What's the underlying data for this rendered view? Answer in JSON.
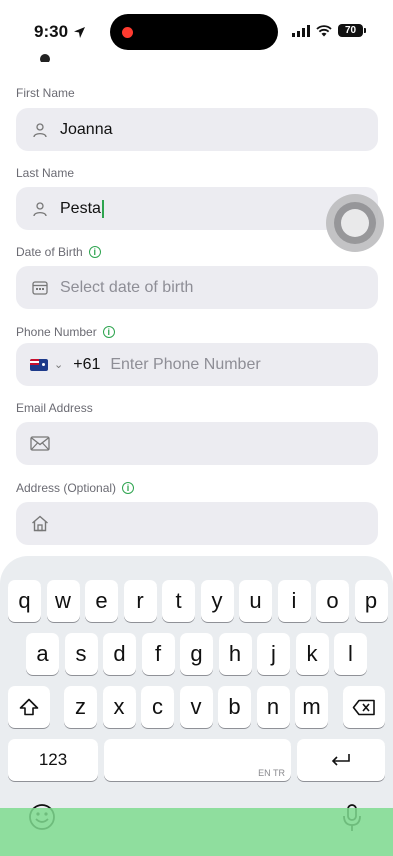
{
  "status_bar": {
    "time": "9:30",
    "battery": "70"
  },
  "form": {
    "first_name": {
      "label": "First Name",
      "value": "Joanna"
    },
    "last_name": {
      "label": "Last Name",
      "value": "Pesta"
    },
    "dob": {
      "label": "Date of Birth",
      "placeholder": "Select date of birth"
    },
    "phone": {
      "label": "Phone Number",
      "country_code": "+61",
      "placeholder": "Enter Phone Number"
    },
    "email": {
      "label": "Email Address",
      "value": ""
    },
    "address": {
      "label": "Address (Optional)",
      "value": ""
    }
  },
  "keyboard": {
    "row1": [
      "q",
      "w",
      "e",
      "r",
      "t",
      "y",
      "u",
      "i",
      "o",
      "p"
    ],
    "row2": [
      "a",
      "s",
      "d",
      "f",
      "g",
      "h",
      "j",
      "k",
      "l"
    ],
    "row3": [
      "z",
      "x",
      "c",
      "v",
      "b",
      "n",
      "m"
    ],
    "numbers_key": "123",
    "language_hint": "EN TR"
  },
  "colors": {
    "accent": "#2ea44f",
    "field_bg": "#ececf1"
  }
}
